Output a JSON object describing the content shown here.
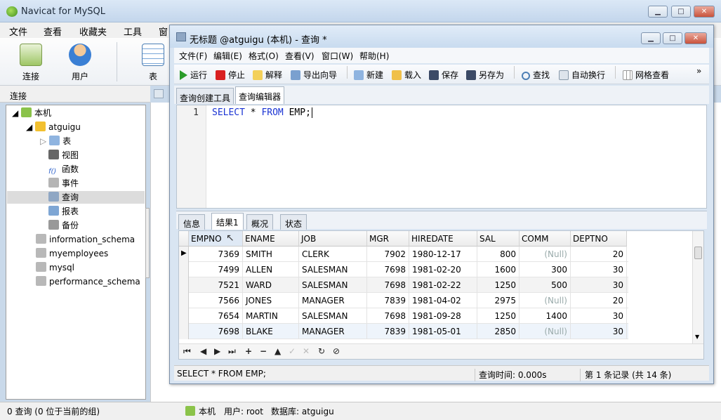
{
  "app": {
    "title": "Navicat for MySQL"
  },
  "outer_menu": [
    "文件",
    "查看",
    "收藏夹",
    "工具",
    "窗"
  ],
  "outer_toolbar": {
    "connect": "连接",
    "user": "用户",
    "table": "表"
  },
  "sidebar": {
    "header": "连接",
    "tree": [
      {
        "label": "本机",
        "icon": "connection-icon"
      },
      {
        "label": "atguigu",
        "icon": "database-icon"
      },
      {
        "label": "表",
        "icon": "table-icon"
      },
      {
        "label": "视图",
        "icon": "view-icon"
      },
      {
        "label": "函数",
        "icon": "function-icon"
      },
      {
        "label": "事件",
        "icon": "event-icon"
      },
      {
        "label": "查询",
        "icon": "query-icon"
      },
      {
        "label": "报表",
        "icon": "report-icon"
      },
      {
        "label": "备份",
        "icon": "backup-icon"
      },
      {
        "label": "information_schema",
        "icon": "database-icon"
      },
      {
        "label": "myemployees",
        "icon": "database-icon"
      },
      {
        "label": "mysql",
        "icon": "database-icon"
      },
      {
        "label": "performance_schema",
        "icon": "database-icon"
      }
    ]
  },
  "status": {
    "left": "0 查询 (0 位于当前的组)",
    "connection": "本机",
    "user": "用户: root",
    "database": "数据库: atguigu"
  },
  "query_window": {
    "title": "无标题 @atguigu (本机) - 查询 *",
    "menu": [
      "文件(F)",
      "编辑(E)",
      "格式(O)",
      "查看(V)",
      "窗口(W)",
      "帮助(H)"
    ],
    "toolbar": {
      "run": "运行",
      "stop": "停止",
      "explain": "解释",
      "export": "导出向导",
      "new": "新建",
      "load": "载入",
      "save": "保存",
      "save_as": "另存为",
      "find": "查找",
      "wrap": "自动换行",
      "grid": "网格查看",
      "more": "»"
    },
    "editor_tabs": [
      "查询创建工具",
      "查询编辑器"
    ],
    "editor": {
      "line": "1",
      "sql_parts": [
        "SELECT",
        " * ",
        "FROM",
        " EMP;"
      ]
    },
    "result_tabs": [
      "信息",
      "结果1",
      "概况",
      "状态"
    ],
    "columns": [
      "EMPNO",
      "ENAME",
      "JOB",
      "MGR",
      "HIREDATE",
      "SAL",
      "COMM",
      "DEPTNO"
    ],
    "rows": [
      [
        "7369",
        "SMITH",
        "CLERK",
        "7902",
        "1980-12-17",
        "800",
        "(Null)",
        "20"
      ],
      [
        "7499",
        "ALLEN",
        "SALESMAN",
        "7698",
        "1981-02-20",
        "1600",
        "300",
        "30"
      ],
      [
        "7521",
        "WARD",
        "SALESMAN",
        "7698",
        "1981-02-22",
        "1250",
        "500",
        "30"
      ],
      [
        "7566",
        "JONES",
        "MANAGER",
        "7839",
        "1981-04-02",
        "2975",
        "(Null)",
        "20"
      ],
      [
        "7654",
        "MARTIN",
        "SALESMAN",
        "7698",
        "1981-09-28",
        "1250",
        "1400",
        "30"
      ],
      [
        "7698",
        "BLAKE",
        "MANAGER",
        "7839",
        "1981-05-01",
        "2850",
        "(Null)",
        "30"
      ]
    ],
    "status": {
      "sql": "SELECT * FROM EMP;",
      "time": "查询时间: 0.000s",
      "records": "第 1 条记录 (共 14 条)"
    }
  }
}
